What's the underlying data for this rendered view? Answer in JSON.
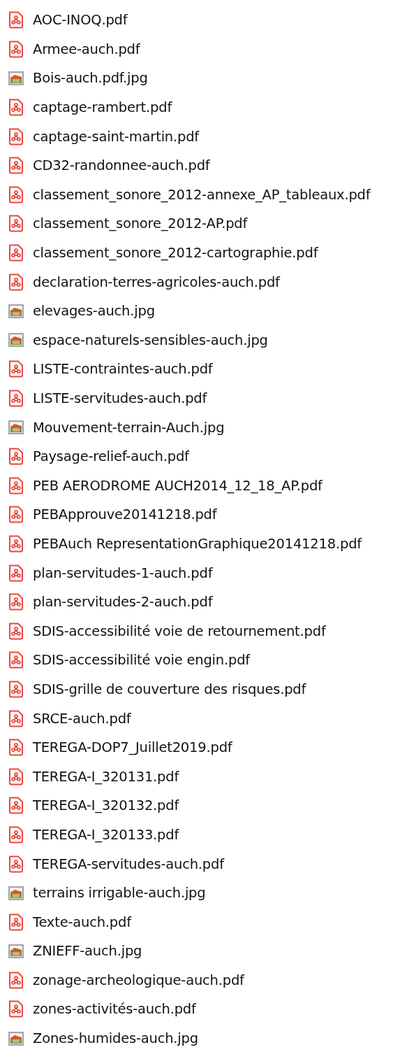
{
  "files": [
    {
      "name": "AOC-INOQ.pdf",
      "kind": "pdf"
    },
    {
      "name": "Armee-auch.pdf",
      "kind": "pdf"
    },
    {
      "name": "Bois-auch.pdf.jpg",
      "kind": "image"
    },
    {
      "name": "captage-rambert.pdf",
      "kind": "pdf"
    },
    {
      "name": "captage-saint-martin.pdf",
      "kind": "pdf"
    },
    {
      "name": "CD32-randonnee-auch.pdf",
      "kind": "pdf"
    },
    {
      "name": "classement_sonore_2012-annexe_AP_tableaux.pdf",
      "kind": "pdf"
    },
    {
      "name": "classement_sonore_2012-AP.pdf",
      "kind": "pdf"
    },
    {
      "name": "classement_sonore_2012-cartographie.pdf",
      "kind": "pdf"
    },
    {
      "name": "declaration-terres-agricoles-auch.pdf",
      "kind": "pdf"
    },
    {
      "name": "elevages-auch.jpg",
      "kind": "image"
    },
    {
      "name": "espace-naturels-sensibles-auch.jpg",
      "kind": "image"
    },
    {
      "name": "LISTE-contraintes-auch.pdf",
      "kind": "pdf"
    },
    {
      "name": "LISTE-servitudes-auch.pdf",
      "kind": "pdf"
    },
    {
      "name": "Mouvement-terrain-Auch.jpg",
      "kind": "image"
    },
    {
      "name": "Paysage-relief-auch.pdf",
      "kind": "pdf"
    },
    {
      "name": "PEB AERODROME AUCH2014_12_18_AP.pdf",
      "kind": "pdf"
    },
    {
      "name": "PEBApprouve20141218.pdf",
      "kind": "pdf"
    },
    {
      "name": "PEBAuch RepresentationGraphique20141218.pdf",
      "kind": "pdf"
    },
    {
      "name": "plan-servitudes-1-auch.pdf",
      "kind": "pdf"
    },
    {
      "name": "plan-servitudes-2-auch.pdf",
      "kind": "pdf"
    },
    {
      "name": "SDIS-accessibilité voie de retournement.pdf",
      "kind": "pdf"
    },
    {
      "name": "SDIS-accessibilité voie engin.pdf",
      "kind": "pdf"
    },
    {
      "name": "SDIS-grille de couverture des risques.pdf",
      "kind": "pdf"
    },
    {
      "name": "SRCE-auch.pdf",
      "kind": "pdf"
    },
    {
      "name": "TEREGA-DOP7_Juillet2019.pdf",
      "kind": "pdf"
    },
    {
      "name": "TEREGA-I_320131.pdf",
      "kind": "pdf"
    },
    {
      "name": "TEREGA-I_320132.pdf",
      "kind": "pdf"
    },
    {
      "name": "TEREGA-I_320133.pdf",
      "kind": "pdf"
    },
    {
      "name": "TEREGA-servitudes-auch.pdf",
      "kind": "pdf"
    },
    {
      "name": "terrains irrigable-auch.jpg",
      "kind": "image"
    },
    {
      "name": "Texte-auch.pdf",
      "kind": "pdf"
    },
    {
      "name": "ZNIEFF-auch.jpg",
      "kind": "image"
    },
    {
      "name": "zonage-archeologique-auch.pdf",
      "kind": "pdf"
    },
    {
      "name": "zones-activités-auch.pdf",
      "kind": "pdf"
    },
    {
      "name": "Zones-humides-auch.jpg",
      "kind": "image"
    }
  ]
}
